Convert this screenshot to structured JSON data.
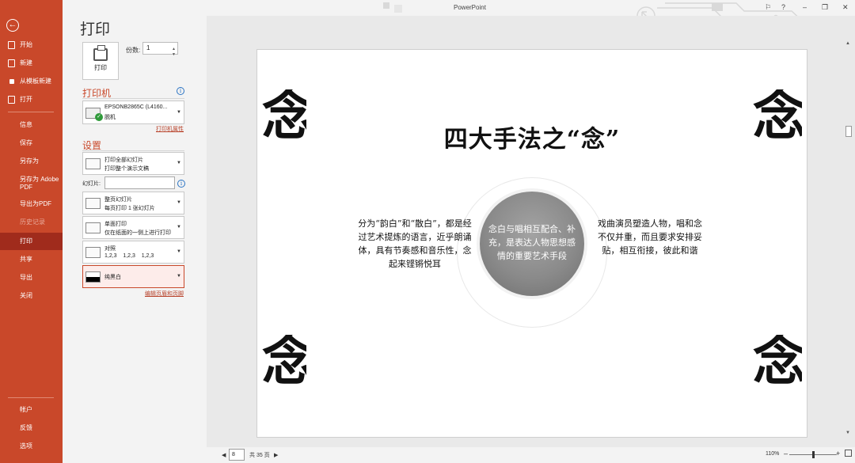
{
  "window": {
    "app_name": "PowerPoint",
    "help": "?",
    "minimize": "–",
    "maximize": "❐",
    "close": "✕"
  },
  "nav": {
    "back": "←",
    "items": [
      {
        "label": "开始"
      },
      {
        "label": "新建"
      },
      {
        "label": "从模板新建"
      },
      {
        "label": "打开"
      },
      {
        "label": "信息"
      },
      {
        "label": "保存"
      },
      {
        "label": "另存为"
      },
      {
        "label": "另存为 Adobe PDF"
      },
      {
        "label": "导出为PDF"
      },
      {
        "label": "历史记录"
      },
      {
        "label": "打印"
      },
      {
        "label": "共享"
      },
      {
        "label": "导出"
      },
      {
        "label": "关闭"
      },
      {
        "label": "帐户"
      },
      {
        "label": "反馈"
      },
      {
        "label": "选项"
      }
    ]
  },
  "print": {
    "title": "打印",
    "print_button": "打印",
    "copies_label": "份数:",
    "copies_value": "1"
  },
  "printer": {
    "heading": "打印机",
    "name": "EPSONB2865C (L4160...",
    "status": "脱机",
    "properties_link": "打印机属性"
  },
  "settings": {
    "heading": "设置",
    "range": {
      "main": "打印全部幻灯片",
      "sub": "打印整个演示文稿"
    },
    "slides_label": "幻灯片:",
    "slides_value": "",
    "layout": {
      "main": "整页幻灯片",
      "sub": "每页打印 1 张幻灯片"
    },
    "sides": {
      "main": "单面打印",
      "sub": "仅在纸面的一侧上进行打印"
    },
    "collate": {
      "main": "对照",
      "sub": "1,2,3    1,2,3    1,2,3"
    },
    "color": {
      "main": "纯黑白"
    },
    "header_footer_link": "编辑页眉和页脚"
  },
  "slide": {
    "title": "四大手法之“念”",
    "corner_tl": "念",
    "corner_tr": "念",
    "corner_bl": "念",
    "corner_br": "念",
    "left_text": "分为“韵白”和“散白”，都是经过艺术提炼的语言，近乎朗诵体，具有节奏感和音乐性，念起来铿锵悦耳",
    "center_text": "念白与唱相互配合、补充，是表达人物思想感情的重要艺术手段",
    "right_text": "戏曲演员塑造人物，唱和念不仅并重，而且要求安排妥贴，相互衔接，彼此和谐"
  },
  "status": {
    "page_value": "8",
    "page_total": "共 35 页",
    "zoom": "110%"
  }
}
